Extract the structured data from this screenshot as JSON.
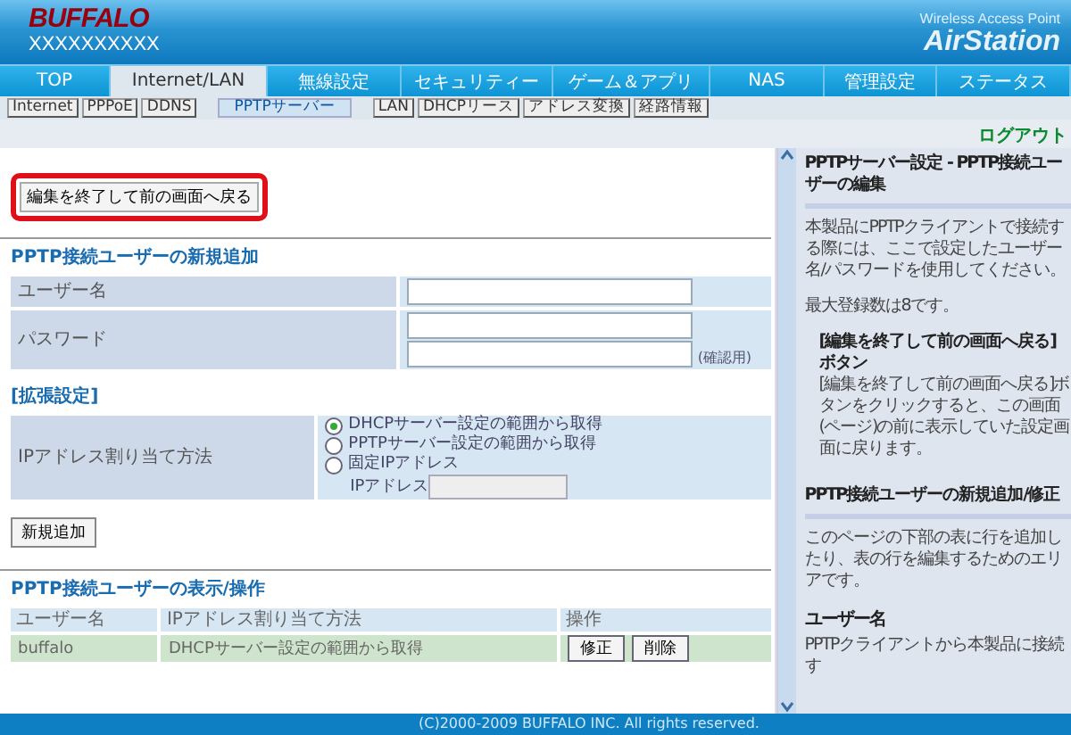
{
  "header": {
    "logo": "BUFFALO",
    "device_name": "XXXXXXXXXX",
    "product_tagline": "Wireless Access Point",
    "product_name": "AirStation"
  },
  "tabs": [
    {
      "label": "TOP",
      "selected": false
    },
    {
      "label": "Internet/LAN",
      "selected": true
    },
    {
      "label": "無線設定",
      "selected": false
    },
    {
      "label": "セキュリティー",
      "selected": false
    },
    {
      "label": "ゲーム＆アプリ",
      "selected": false
    },
    {
      "label": "NAS",
      "selected": false
    },
    {
      "label": "管理設定",
      "selected": false
    },
    {
      "label": "ステータス",
      "selected": false
    }
  ],
  "subtabs": [
    {
      "label": "Internet",
      "selected": false
    },
    {
      "label": "PPPoE",
      "selected": false
    },
    {
      "label": "DDNS",
      "selected": false
    },
    {
      "label": "PPTPサーバー",
      "selected": true
    },
    {
      "label": "LAN",
      "selected": false
    },
    {
      "label": "DHCPリース",
      "selected": false
    },
    {
      "label": "アドレス変換",
      "selected": false
    },
    {
      "label": "経路情報",
      "selected": false
    }
  ],
  "logout": "ログアウト",
  "back_button": "編集を終了して前の画面へ戻る",
  "add_section": {
    "title": "PPTP接続ユーザーの新規追加",
    "username_label": "ユーザー名",
    "password_label": "パスワード",
    "confirm_note": "(確認用)"
  },
  "advanced": {
    "title": "[拡張設定]",
    "ip_label": "IPアドレス割り当て方法",
    "options": [
      {
        "label": "DHCPサーバー設定の範囲から取得",
        "selected": true
      },
      {
        "label": "PPTPサーバー設定の範囲から取得",
        "selected": false
      },
      {
        "label": "固定IPアドレス",
        "selected": false
      }
    ],
    "ip_field_label": "IPアドレス"
  },
  "add_button": "新規追加",
  "list_section": {
    "title": "PPTP接続ユーザーの表示/操作",
    "columns": [
      "ユーザー名",
      "IPアドレス割り当て方法",
      "操作"
    ],
    "rows": [
      {
        "user": "buffalo",
        "method": "DHCPサーバー設定の範囲から取得",
        "actions": [
          "修正",
          "削除"
        ]
      }
    ]
  },
  "help": [
    {
      "kind": "heading",
      "text": "PPTPサーバー設定 - PPTP接続ユーザーの編集"
    },
    {
      "kind": "paragraph",
      "text": "本製品にPPTPクライアントで接続する際には、ここで設定したユーザー名/パスワードを使用してください。"
    },
    {
      "kind": "paragraph",
      "text": "最大登録数は8です。"
    },
    {
      "kind": "subheading",
      "text": "[編集を終了して前の画面へ戻る]ボタン"
    },
    {
      "kind": "subparagraph",
      "text": "[編集を終了して前の画面へ戻る]ボタンをクリックすると、この画面(ページ)の前に表示していた設定画面に戻ります。"
    },
    {
      "kind": "heading",
      "text": "PPTP接続ユーザーの新規追加/修正"
    },
    {
      "kind": "paragraph",
      "text": "このページの下部の表に行を追加したり、表の行を編集するためのエリアです。"
    },
    {
      "kind": "title",
      "text": "ユーザー名"
    },
    {
      "kind": "paragraph",
      "text": "PPTPクライアントから本製品に接続す"
    }
  ],
  "footer": "(C)2000-2009 BUFFALO INC. All rights reserved."
}
